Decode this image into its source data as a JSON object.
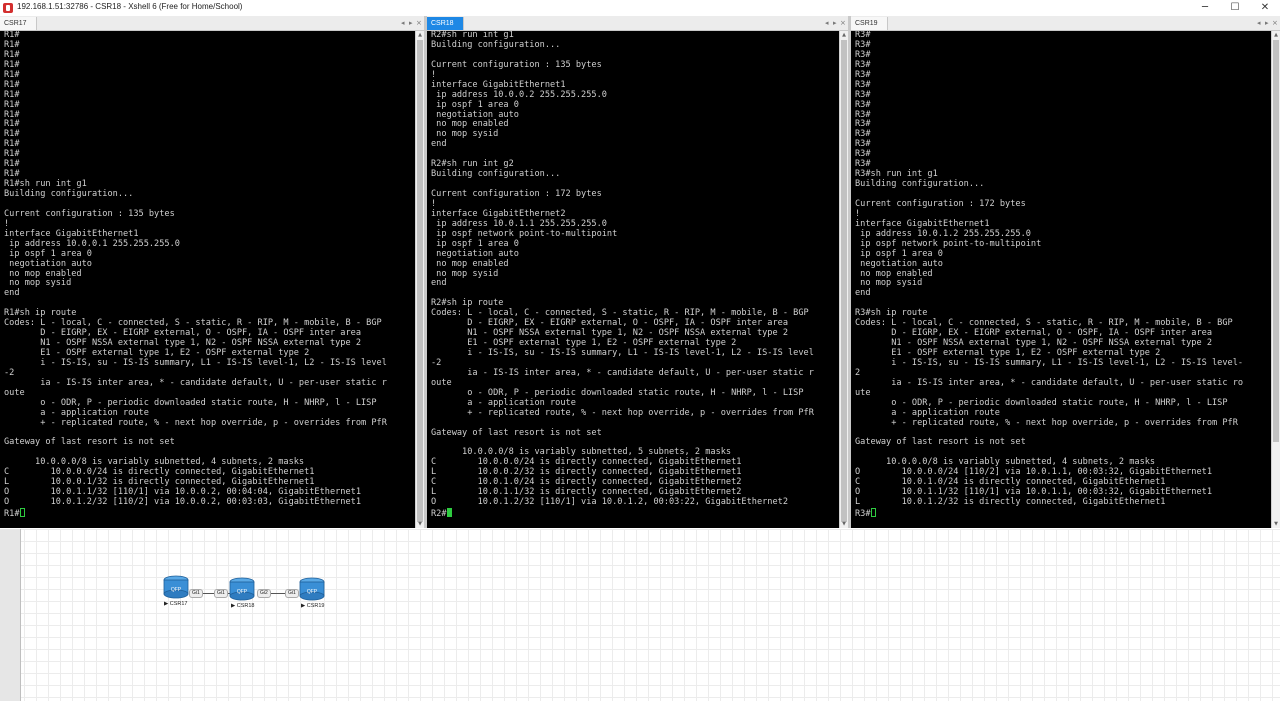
{
  "window": {
    "title": "192.168.1.51:32786 - CSR18 - Xshell 6 (Free for Home/School)",
    "controls": {
      "minimize": "─",
      "maximize": "☐",
      "close": "✕"
    }
  },
  "panes": {
    "left": {
      "tab_label": "CSR17",
      "lines": [
        "R1#",
        "R1#",
        "R1#",
        "R1#",
        "R1#",
        "R1#",
        "R1#",
        "R1#",
        "R1#",
        "R1#",
        "R1#",
        "R1#",
        "R1#",
        "R1#",
        "R1#",
        "R1#sh run int g1",
        "Building configuration...",
        "",
        "Current configuration : 135 bytes",
        "!",
        "interface GigabitEthernet1",
        " ip address 10.0.0.1 255.255.255.0",
        " ip ospf 1 area 0",
        " negotiation auto",
        " no mop enabled",
        " no mop sysid",
        "end",
        "",
        "R1#sh ip route",
        "Codes: L - local, C - connected, S - static, R - RIP, M - mobile, B - BGP",
        "       D - EIGRP, EX - EIGRP external, O - OSPF, IA - OSPF inter area",
        "       N1 - OSPF NSSA external type 1, N2 - OSPF NSSA external type 2",
        "       E1 - OSPF external type 1, E2 - OSPF external type 2",
        "       i - IS-IS, su - IS-IS summary, L1 - IS-IS level-1, L2 - IS-IS level",
        "-2",
        "       ia - IS-IS inter area, * - candidate default, U - per-user static r",
        "oute",
        "       o - ODR, P - periodic downloaded static route, H - NHRP, l - LISP",
        "       a - application route",
        "       + - replicated route, % - next hop override, p - overrides from PfR",
        "",
        "Gateway of last resort is not set",
        "",
        "      10.0.0.0/8 is variably subnetted, 4 subnets, 2 masks",
        "C        10.0.0.0/24 is directly connected, GigabitEthernet1",
        "L        10.0.0.1/32 is directly connected, GigabitEthernet1",
        "O        10.0.1.1/32 [110/1] via 10.0.0.2, 00:04:04, GigabitEthernet1",
        "O        10.0.1.2/32 [110/2] via 10.0.0.2, 00:03:03, GigabitEthernet1"
      ],
      "prompt": "R1#"
    },
    "middle": {
      "tab_label": "CSR18",
      "lines": [
        "R2#sh run int g1",
        "Building configuration...",
        "",
        "Current configuration : 135 bytes",
        "!",
        "interface GigabitEthernet1",
        " ip address 10.0.0.2 255.255.255.0",
        " ip ospf 1 area 0",
        " negotiation auto",
        " no mop enabled",
        " no mop sysid",
        "end",
        "",
        "R2#sh run int g2",
        "Building configuration...",
        "",
        "Current configuration : 172 bytes",
        "!",
        "interface GigabitEthernet2",
        " ip address 10.0.1.1 255.255.255.0",
        " ip ospf network point-to-multipoint",
        " ip ospf 1 area 0",
        " negotiation auto",
        " no mop enabled",
        " no mop sysid",
        "end",
        "",
        "R2#sh ip route",
        "Codes: L - local, C - connected, S - static, R - RIP, M - mobile, B - BGP",
        "       D - EIGRP, EX - EIGRP external, O - OSPF, IA - OSPF inter area",
        "       N1 - OSPF NSSA external type 1, N2 - OSPF NSSA external type 2",
        "       E1 - OSPF external type 1, E2 - OSPF external type 2",
        "       i - IS-IS, su - IS-IS summary, L1 - IS-IS level-1, L2 - IS-IS level",
        "-2",
        "       ia - IS-IS inter area, * - candidate default, U - per-user static r",
        "oute",
        "       o - ODR, P - periodic downloaded static route, H - NHRP, l - LISP",
        "       a - application route",
        "       + - replicated route, % - next hop override, p - overrides from PfR",
        "",
        "Gateway of last resort is not set",
        "",
        "      10.0.0.0/8 is variably subnetted, 5 subnets, 2 masks",
        "C        10.0.0.0/24 is directly connected, GigabitEthernet1",
        "L        10.0.0.2/32 is directly connected, GigabitEthernet1",
        "C        10.0.1.0/24 is directly connected, GigabitEthernet2",
        "L        10.0.1.1/32 is directly connected, GigabitEthernet2",
        "O        10.0.1.2/32 [110/1] via 10.0.1.2, 00:03:22, GigabitEthernet2"
      ],
      "prompt": "R2#"
    },
    "right": {
      "tab_label": "CSR19",
      "lines": [
        "R3#",
        "R3#",
        "R3#",
        "R3#",
        "R3#",
        "R3#",
        "R3#",
        "R3#",
        "R3#",
        "R3#",
        "R3#",
        "R3#",
        "R3#",
        "R3#",
        "R3#sh run int g1",
        "Building configuration...",
        "",
        "Current configuration : 172 bytes",
        "!",
        "interface GigabitEthernet1",
        " ip address 10.0.1.2 255.255.255.0",
        " ip ospf network point-to-multipoint",
        " ip ospf 1 area 0",
        " negotiation auto",
        " no mop enabled",
        " no mop sysid",
        "end",
        "",
        "R3#sh ip route",
        "Codes: L - local, C - connected, S - static, R - RIP, M - mobile, B - BGP",
        "       D - EIGRP, EX - EIGRP external, O - OSPF, IA - OSPF inter area",
        "       N1 - OSPF NSSA external type 1, N2 - OSPF NSSA external type 2",
        "       E1 - OSPF external type 1, E2 - OSPF external type 2",
        "       i - IS-IS, su - IS-IS summary, L1 - IS-IS level-1, L2 - IS-IS level-",
        "2",
        "       ia - IS-IS inter area, * - candidate default, U - per-user static ro",
        "ute",
        "       o - ODR, P - periodic downloaded static route, H - NHRP, l - LISP",
        "       a - application route",
        "       + - replicated route, % - next hop override, p - overrides from PfR",
        "",
        "Gateway of last resort is not set",
        "",
        "      10.0.0.0/8 is variably subnetted, 4 subnets, 2 masks",
        "O        10.0.0.0/24 [110/2] via 10.0.1.1, 00:03:32, GigabitEthernet1",
        "C        10.0.1.0/24 is directly connected, GigabitEthernet1",
        "O        10.0.1.1/32 [110/1] via 10.0.1.1, 00:03:32, GigabitEthernet1",
        "L        10.0.1.2/32 is directly connected, GigabitEthernet1"
      ],
      "prompt": "R3#"
    }
  },
  "topology": {
    "nodes": [
      {
        "label": "CSR17",
        "icon_text": "QFP"
      },
      {
        "label": "CSR18",
        "icon_text": "QFP"
      },
      {
        "label": "CSR19",
        "icon_text": "QFP"
      }
    ],
    "links": [
      {
        "label": "Gi1"
      },
      {
        "label": "Gi1"
      },
      {
        "label": "Gi2"
      },
      {
        "label": "Gi1"
      }
    ]
  },
  "colors": {
    "terminal_bg": "#000000",
    "terminal_fg": "#d0d0d0",
    "active_tab": "#1e88e5",
    "cursor": "#2ecc40",
    "router_icon": "#3a8fd6"
  }
}
